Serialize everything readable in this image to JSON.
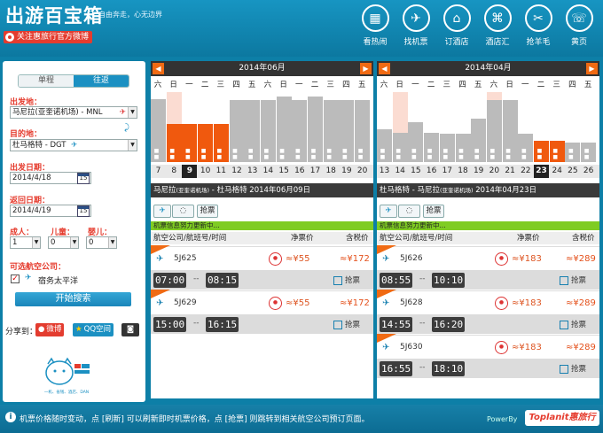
{
  "header": {
    "logo": "出游百宝箱",
    "slogan": "自由奔走，心无边界",
    "follow": "关注惠旅行官方微博",
    "nav": [
      {
        "label": "看热闹",
        "icon": "calendar-icon"
      },
      {
        "label": "找机票",
        "icon": "plane-icon"
      },
      {
        "label": "订酒店",
        "icon": "hotel-icon"
      },
      {
        "label": "酒店汇",
        "icon": "hotel-group-icon"
      },
      {
        "label": "抢羊毛",
        "icon": "coupon-icon"
      },
      {
        "label": "黄页",
        "icon": "phone-icon"
      }
    ]
  },
  "search": {
    "tab_oneway": "单程",
    "tab_round": "往返",
    "from_label": "出发地：",
    "from_value": "马尼拉(亚奎诺机场) - MNL",
    "to_label": "目的地：",
    "to_value": "杜马格特 - DGT",
    "depart_label": "出发日期：",
    "depart_value": "2014/4/18",
    "return_label": "返回日期：",
    "return_value": "2014/4/19",
    "cal_icon_text": "15",
    "adult_label": "成人：",
    "adult_value": "1",
    "child_label": "儿童：",
    "child_value": "0",
    "infant_label": "婴儿：",
    "infant_value": "0",
    "airline_label": "可选航空公司：",
    "airline_value": "宿务太平洋",
    "search_button": "开始搜索",
    "share_label": "分享到：",
    "share_weibo": "微博",
    "share_qq": "QQ空间",
    "mascot_text": "一机、省钱、酒店、DAN"
  },
  "calendars": [
    {
      "month": "2014年06月",
      "weekdays": [
        "六",
        "日",
        "一",
        "二",
        "三",
        "四",
        "五",
        "六",
        "日",
        "一",
        "二",
        "三",
        "四",
        "五"
      ],
      "days": [
        "7",
        "8",
        "9",
        "10",
        "11",
        "12",
        "13",
        "14",
        "15",
        "16",
        "17",
        "18",
        "19",
        "20"
      ],
      "selected_index": 2,
      "levels": [
        0.9,
        0.55,
        0.55,
        0.55,
        0.55,
        0.88,
        0.88,
        0.88,
        0.94,
        0.88,
        0.94,
        0.88,
        0.88,
        0.88
      ],
      "orange": [
        false,
        true,
        true,
        true,
        true,
        false,
        false,
        false,
        false,
        false,
        false,
        false,
        false,
        false
      ],
      "pink": [
        false,
        true,
        false,
        false,
        false,
        false,
        false,
        false,
        false,
        false,
        false,
        false,
        false,
        false
      ],
      "route": "马尼拉",
      "route_sub1": "(亚奎诺机场)",
      "route_mid": " - 杜马格特 ",
      "route_date": "2014年06月09日",
      "filter_btn": "抢票",
      "updating": "机票信息努力更新中...",
      "col_airline": "航空公司/航班号/时间",
      "col_net": "净票价",
      "col_tax": "含税价",
      "flights": [
        {
          "no": "5J625",
          "net": "≈¥55",
          "tax": "≈¥172",
          "dep": "07:00",
          "arr": "08:15",
          "book": "抢票"
        },
        {
          "no": "5J629",
          "net": "≈¥55",
          "tax": "≈¥172",
          "dep": "15:00",
          "arr": "16:15",
          "book": "抢票"
        }
      ]
    },
    {
      "month": "2014年04月",
      "weekdays": [
        "六",
        "日",
        "一",
        "二",
        "三",
        "四",
        "五",
        "六",
        "日",
        "一",
        "二",
        "三",
        "四",
        "五"
      ],
      "days": [
        "13",
        "14",
        "15",
        "16",
        "17",
        "18",
        "19",
        "20",
        "21",
        "22",
        "23",
        "24",
        "25",
        "26"
      ],
      "selected_index": 10,
      "levels": [
        0.47,
        0.42,
        0.57,
        0.42,
        0.4,
        0.4,
        0.62,
        0.88,
        0.88,
        0.4,
        0.3,
        0.3,
        0.28,
        0.28
      ],
      "orange": [
        false,
        false,
        false,
        false,
        false,
        false,
        false,
        false,
        false,
        false,
        true,
        true,
        false,
        false
      ],
      "pink": [
        false,
        true,
        false,
        false,
        false,
        false,
        false,
        true,
        false,
        false,
        false,
        false,
        false,
        false
      ],
      "route": "杜马格特 - 马尼拉",
      "route_sub1": "(亚奎诺机场)",
      "route_mid": " ",
      "route_date": "2014年04月23日",
      "filter_btn": "抢票",
      "updating": "机票信息努力更新中...",
      "col_airline": "航空公司/航班号/时间",
      "col_net": "净票价",
      "col_tax": "含税价",
      "flights": [
        {
          "no": "5J626",
          "net": "≈¥183",
          "tax": "≈¥289",
          "dep": "08:55",
          "arr": "10:10",
          "book": "抢票"
        },
        {
          "no": "5J628",
          "net": "≈¥183",
          "tax": "≈¥289",
          "dep": "14:55",
          "arr": "16:20",
          "book": "抢票"
        },
        {
          "no": "5J630",
          "net": "≈¥183",
          "tax": "≈¥289",
          "dep": "16:55",
          "arr": "18:10",
          "book": "抢票"
        }
      ]
    }
  ],
  "footer": {
    "message": "机票价格随时变动，点 [刷新] 可以刷新即时机票价格，点 [抢票] 则跳转到相关航空公司预订页面。",
    "powered": "PowerBy",
    "brand": "Toplanit惠旅行"
  },
  "colors": {
    "accent": "#1b90c2",
    "orange": "#f0590e",
    "red": "#e53c2e",
    "green": "#7fcc22"
  }
}
